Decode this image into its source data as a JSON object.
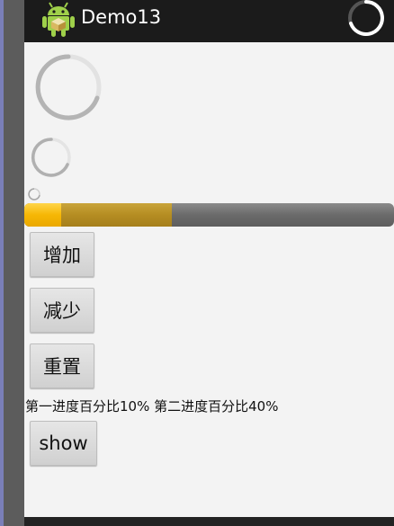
{
  "app": {
    "title": "Demo13",
    "icon": "android-icon"
  },
  "progress": {
    "primary_percent": 10,
    "secondary_percent": 40
  },
  "progress_text": "第一进度百分比10%  第二进度百分比40%",
  "buttons": {
    "add": "增加",
    "subtract": "减少",
    "reset": "重置",
    "show": "show"
  },
  "colors": {
    "titlebar": "#1b1b1b",
    "primary_progress": "#f6b705",
    "secondary_progress": "#b58d22",
    "track": "#6b6b6b",
    "content_bg": "#f3f3f3"
  }
}
